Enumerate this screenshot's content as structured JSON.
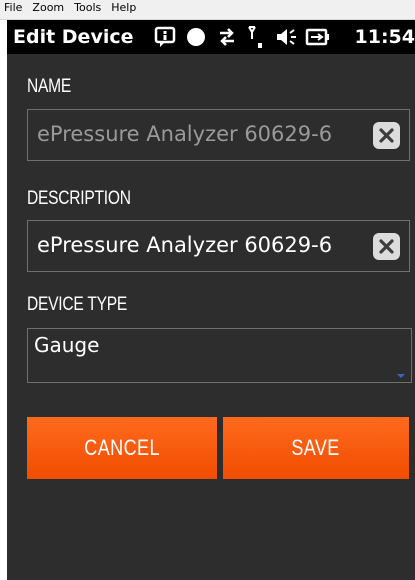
{
  "menu": {
    "items": [
      "File",
      "Zoom",
      "Tools",
      "Help"
    ]
  },
  "status_bar": {
    "title": "Edit Device",
    "time": "11:54",
    "icons": [
      "notification-icon",
      "record-dot-icon",
      "data-transfer-icon",
      "signal-strength-icon",
      "volume-icon",
      "battery-charging-icon"
    ]
  },
  "form": {
    "name": {
      "label": "NAME",
      "value": "ePressure Analyzer 60629-6"
    },
    "description": {
      "label": "DESCRIPTION",
      "value": "ePressure Analyzer 60629-6"
    },
    "device_type": {
      "label": "DEVICE TYPE",
      "value": "Gauge"
    }
  },
  "buttons": {
    "cancel": "CANCEL",
    "save": "SAVE"
  },
  "colors": {
    "background": "#2d2d2d",
    "accent": "#f95c0f",
    "field_border": "#6f6f6f",
    "disabled_text": "#9a9a9a"
  }
}
